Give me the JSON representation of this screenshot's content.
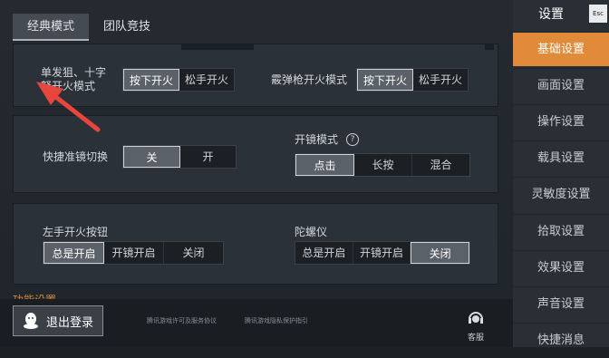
{
  "tabs": [
    {
      "label": "经典模式",
      "active": true
    },
    {
      "label": "团队竞技",
      "active": false
    }
  ],
  "fire": {
    "sniper_label": "单发狙、十字弩开火模式",
    "sniper_label_line1": "单发狙、十字",
    "sniper_label_line2": "弩开火模式",
    "sniper_options": [
      "按下开火",
      "松手开火"
    ],
    "sniper_selected": "按下开火",
    "shotgun_label": "霰弹枪开火模式",
    "shotgun_options": [
      "按下开火",
      "松手开火"
    ],
    "shotgun_selected": "按下开火"
  },
  "scope": {
    "quick_scope_label": "快捷准镜切换",
    "quick_scope_options": [
      "关",
      "开"
    ],
    "quick_scope_selected": "关",
    "mode_label": "开镜模式",
    "mode_help": "?",
    "mode_options": [
      "点击",
      "长按",
      "混合"
    ],
    "mode_selected": "点击"
  },
  "extra": {
    "left_fire_label": "左手开火按钮",
    "left_fire_options": [
      "总是开启",
      "开镜开启",
      "关闭"
    ],
    "left_fire_selected": "总是开启",
    "gyro_label": "陀螺仪",
    "gyro_options": [
      "总是开启",
      "开镜开启",
      "关闭"
    ],
    "gyro_selected": "关闭"
  },
  "section_title": "功能设置",
  "bottom": {
    "logout_label": "退出登录",
    "link1": "腾讯游戏许可及服务协议",
    "link2": "腾讯游戏隐私保护指引",
    "service_label": "客服"
  },
  "sidebar": {
    "title": "设置",
    "esc": "Esc",
    "items": [
      "基础设置",
      "画面设置",
      "操作设置",
      "载具设置",
      "灵敏度设置",
      "拾取设置",
      "效果设置",
      "声音设置",
      "快捷消息"
    ],
    "active": "基础设置"
  },
  "colors": {
    "accent": "#e08a3a",
    "panel": "#2b3138",
    "arrow": "#e8453c"
  }
}
